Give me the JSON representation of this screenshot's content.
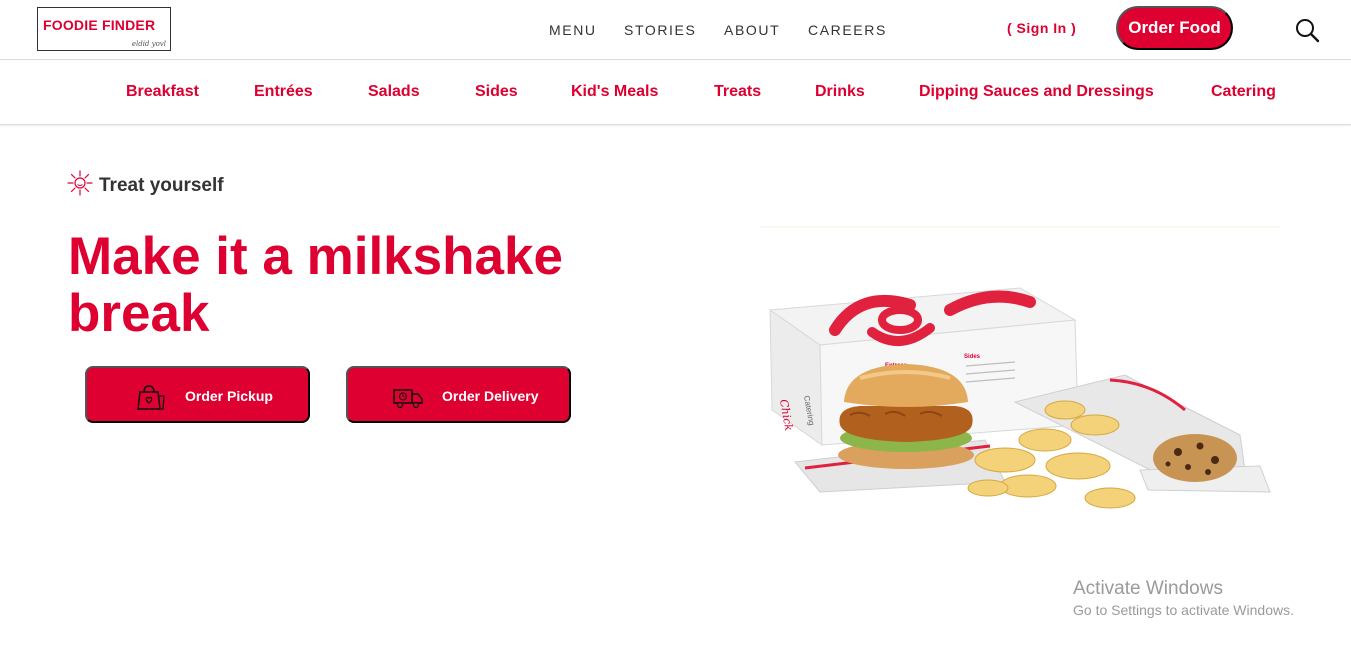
{
  "brand": {
    "name": "FOODIE FINDER",
    "tagline": "eldid yovl"
  },
  "nav": {
    "items": [
      "MENU",
      "STORIES",
      "ABOUT",
      "CAREERS"
    ],
    "signin": "( Sign In )",
    "order_food": "Order Food"
  },
  "categories": [
    "Breakfast",
    "Entrées",
    "Salads",
    "Sides",
    "Kid's Meals",
    "Treats",
    "Drinks",
    "Dipping Sauces and Dressings",
    "Catering"
  ],
  "hero": {
    "eyebrow": "Treat yourself",
    "headline": "Make it a milkshake break",
    "pickup_label": "Order Pickup",
    "delivery_label": "Order Delivery"
  },
  "product_box": {
    "catering_label": "Catering",
    "entrees_label": "Entrees",
    "sides_label": "Sides"
  },
  "watermark": {
    "title": "Activate Windows",
    "subtitle": "Go to Settings to activate Windows."
  },
  "colors": {
    "accent": "#dd0031",
    "text": "#333333"
  },
  "icons": {
    "eyebrow": "sun-icon",
    "search": "search-icon",
    "pickup": "shopping-bag-icon",
    "delivery": "delivery-truck-icon"
  }
}
